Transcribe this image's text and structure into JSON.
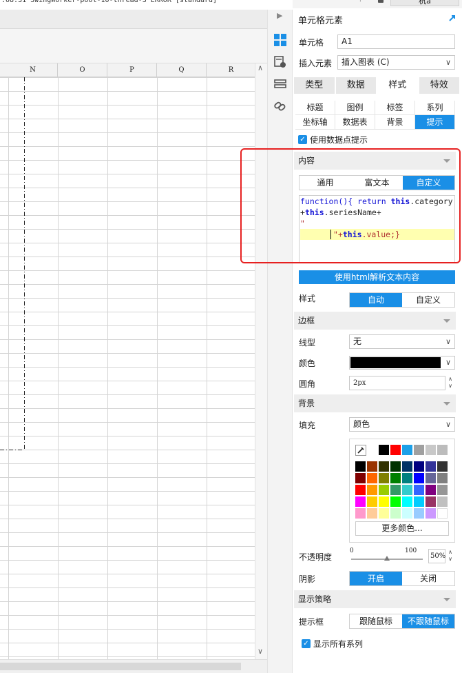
{
  "logbar": {
    "text": ":08:31 SwingWorker-pool-10-thread-3 ERROR [standard]"
  },
  "topbar": {
    "user_label": "杭a"
  },
  "sheet": {
    "columns": [
      "N",
      "O",
      "P",
      "Q",
      "R"
    ]
  },
  "panel": {
    "title": "单元格元素",
    "cell_label": "单元格",
    "cell_value": "A1",
    "insert_label": "插入元素",
    "insert_value": "插入图表 (C)",
    "main_tabs": [
      "类型",
      "数据",
      "样式",
      "特效"
    ],
    "main_tab_active": "样式",
    "sub_tabs_row1": [
      "标题",
      "图例",
      "标签",
      "系列"
    ],
    "sub_tabs_row2": [
      "坐标轴",
      "数据表",
      "背景",
      "提示"
    ],
    "sub_tab_active": "提示",
    "use_tooltip_label": "使用数据点提示",
    "content_section": "内容",
    "content_modes": [
      "通用",
      "富文本",
      "自定义"
    ],
    "content_mode_active": "自定义",
    "code": {
      "line1_kw1": "function",
      "line1_mid": "(){ ",
      "line1_kw2": "return",
      "line1_sp": " ",
      "line1_kw3": "this",
      "line1_end": ".category",
      "line2_plus": "+",
      "line2_kw": "this",
      "line2_end": ".seriesName+",
      "line3": "\"",
      "line4_q": "\"+",
      "line4_kw": "this",
      "line4_end": ".value;}"
    },
    "html_parse_button": "使用html解析文本内容",
    "style_label": "样式",
    "style_modes": [
      "自动",
      "自定义"
    ],
    "style_mode_active": "自动",
    "border_section": "边框",
    "line_type_label": "线型",
    "line_type_value": "无",
    "color_label": "颜色",
    "color_value": "#000000",
    "radius_label": "圆角",
    "radius_value": "2px",
    "background_section": "背景",
    "fill_label": "填充",
    "fill_value": "颜色",
    "palette": {
      "top_row": [
        "#000000",
        "#ff0000",
        "#1ca0e8",
        "#a0a0a0",
        "#c8c8c8",
        "#bcbcbc"
      ],
      "grid": [
        [
          "#000000",
          "#993300",
          "#333300",
          "#003300",
          "#003366",
          "#000080",
          "#333399",
          "#333333"
        ],
        [
          "#800000",
          "#ff6600",
          "#808000",
          "#008000",
          "#008080",
          "#0000ff",
          "#666699",
          "#808080"
        ],
        [
          "#ff0000",
          "#ff9900",
          "#99cc00",
          "#339966",
          "#33cccc",
          "#3366ff",
          "#800080",
          "#969696"
        ],
        [
          "#ff00ff",
          "#ffcc00",
          "#ffff00",
          "#00ff00",
          "#00ffff",
          "#00ccff",
          "#993366",
          "#c0c0c0"
        ],
        [
          "#ff99cc",
          "#ffcc99",
          "#ffff99",
          "#ccffcc",
          "#ccffff",
          "#99ccff",
          "#cc99ff",
          "#ffffff"
        ]
      ],
      "more_colors": "更多颜色..."
    },
    "opacity_label": "不透明度",
    "opacity_min": "0",
    "opacity_max": "100",
    "opacity_value": "50%",
    "opacity_level": 50,
    "shadow_label": "阴影",
    "shadow_modes": [
      "开启",
      "关闭"
    ],
    "shadow_active": "开启",
    "display_section": "显示策略",
    "tooltip_box_label": "提示框",
    "tooltip_box_modes": [
      "跟随鼠标",
      "不跟随鼠标"
    ],
    "tooltip_box_active": "不跟随鼠标",
    "show_all_series_label": "显示所有系列"
  }
}
